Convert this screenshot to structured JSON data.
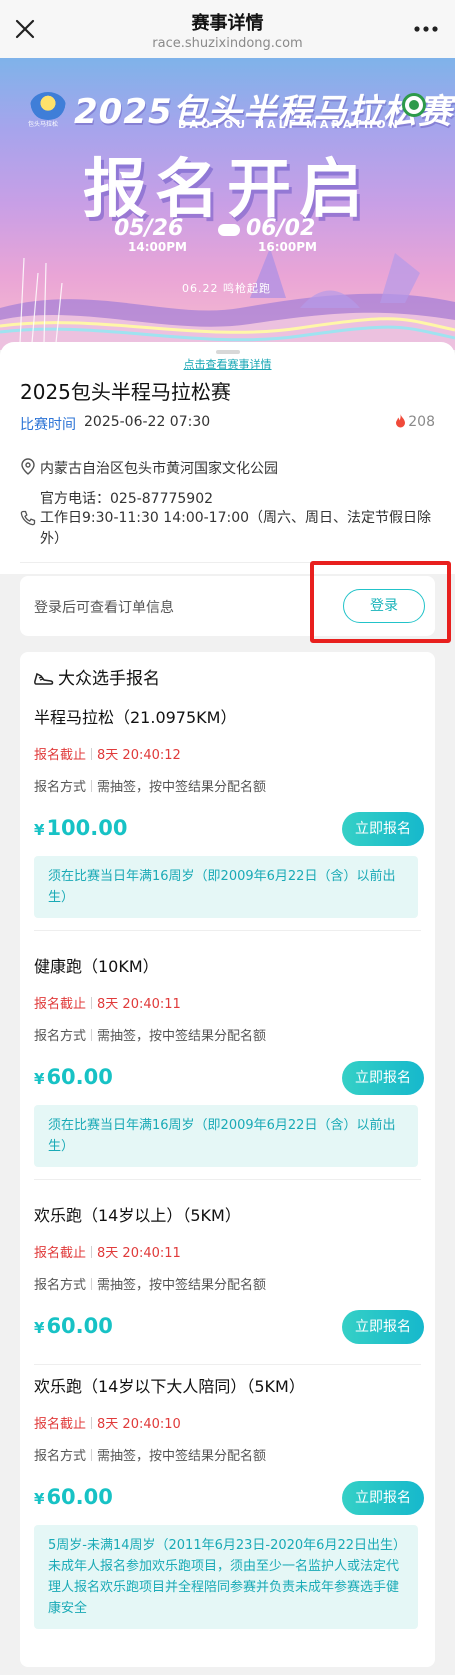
{
  "nav": {
    "title": "赛事详情",
    "url": "race.shuzixindong.com",
    "close_icon": "close-icon",
    "more_icon": "more-dots-icon"
  },
  "banner": {
    "title": "2025包头半程马拉松赛",
    "subtitle": "BAOTOU HALF MARATHON",
    "headline": "报名开启",
    "date_start": "05/26",
    "date_end": "06/02",
    "time_start": "14:00PM",
    "time_end": "16:00PM",
    "start_note": "06.22 鸣枪起跑",
    "logo_caption": "包头马拉松"
  },
  "race": {
    "detail_link": "点击查看赛事详情",
    "name": "2025包头半程马拉松赛",
    "time_label": "比赛时间",
    "time": "2025-06-22 07:30",
    "hot_count": "208",
    "address": "内蒙古自治区包头市黄河国家文化公园",
    "phone": "官方电话：025-87775902",
    "hours": "工作日9:30-11:30 14:00-17:00（周六、周日、法定节假日除外）"
  },
  "login": {
    "hint": "登录后可查看订单信息",
    "button": "登录"
  },
  "events_section": {
    "title": "大众选手报名",
    "icon": "running-shoe-icon"
  },
  "events": [
    {
      "name": "半程马拉松（21.0975KM）",
      "deadline_label": "报名截止",
      "deadline": "8天 20:40:12",
      "method_label": "报名方式",
      "method": "需抽签，按中签结果分配名额",
      "currency": "¥",
      "price": "100.00",
      "button": "立即报名",
      "note": "须在比赛当日年满16周岁（即2009年6月22日（含）以前出生）"
    },
    {
      "name": "健康跑（10KM）",
      "deadline_label": "报名截止",
      "deadline": "8天 20:40:11",
      "method_label": "报名方式",
      "method": "需抽签，按中签结果分配名额",
      "currency": "¥",
      "price": "60.00",
      "button": "立即报名",
      "note": "须在比赛当日年满16周岁（即2009年6月22日（含）以前出生）"
    },
    {
      "name": "欢乐跑（14岁以上）（5KM）",
      "deadline_label": "报名截止",
      "deadline": "8天 20:40:11",
      "method_label": "报名方式",
      "method": "需抽签，按中签结果分配名额",
      "currency": "¥",
      "price": "60.00",
      "button": "立即报名"
    },
    {
      "name": "欢乐跑（14岁以下大人陪同）（5KM）",
      "deadline_label": "报名截止",
      "deadline": "8天 20:40:10",
      "method_label": "报名方式",
      "method": "需抽签，按中签结果分配名额",
      "currency": "¥",
      "price": "60.00",
      "button": "立即报名",
      "note": "5周岁-未满14周岁（2011年6月23日-2020年6月22日出生）未成年人报名参加欢乐跑项目，须由至少一名监护人或法定代理人报名欢乐跑项目并全程陪同参赛并负责未成年参赛选手健康安全"
    }
  ],
  "colors": {
    "accent": "#17c2c5",
    "deadline": "#e03a3a",
    "time_label": "#2b73d6",
    "highlight": "#e8201e",
    "note_bg": "#e5f7f6"
  }
}
